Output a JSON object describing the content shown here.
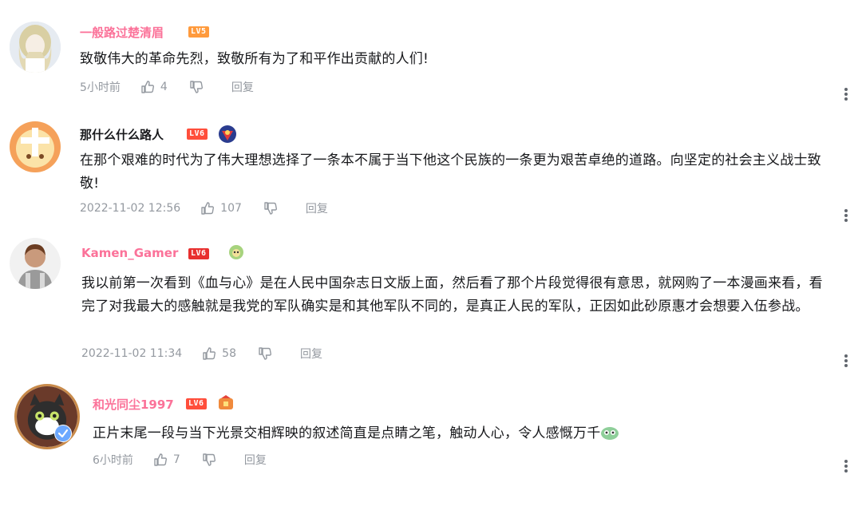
{
  "comments": [
    {
      "username": "一般路过楚清眉",
      "level": "LV5",
      "text": "致敬伟大的革命先烈，致敬所有为了和平作出贡献的人们!",
      "time": "5小时前",
      "likes": "4",
      "reply": "回复"
    },
    {
      "username": "那什么什么路人",
      "level": "LV6",
      "text": "在那个艰难的时代为了伟大理想选择了一条本不属于当下他这个民族的一条更为艰苦卓绝的道路。向坚定的社会主义战士致敬!",
      "time": "2022-11-02 12:56",
      "likes": "107",
      "reply": "回复"
    },
    {
      "username": "Kamen_Gamer",
      "level": "LV6",
      "text": "我以前第一次看到《血与心》是在人民中国杂志日文版上面，然后看了那个片段觉得很有意思，就网购了一本漫画来看，看完了对我最大的感触就是我党的军队确实是和其他军队不同的，是真正人民的军队，正因如此砂原惠才会想要入伍参战。",
      "time": "2022-11-02 11:34",
      "likes": "58",
      "reply": "回复"
    },
    {
      "username": "和光同尘1997",
      "level": "LV6",
      "text": "正片末尾一段与当下光景交相辉映的叙述简直是点睛之笔，触动人心，令人感慨万千",
      "time": "6小时前",
      "likes": "7",
      "reply": "回复"
    }
  ]
}
